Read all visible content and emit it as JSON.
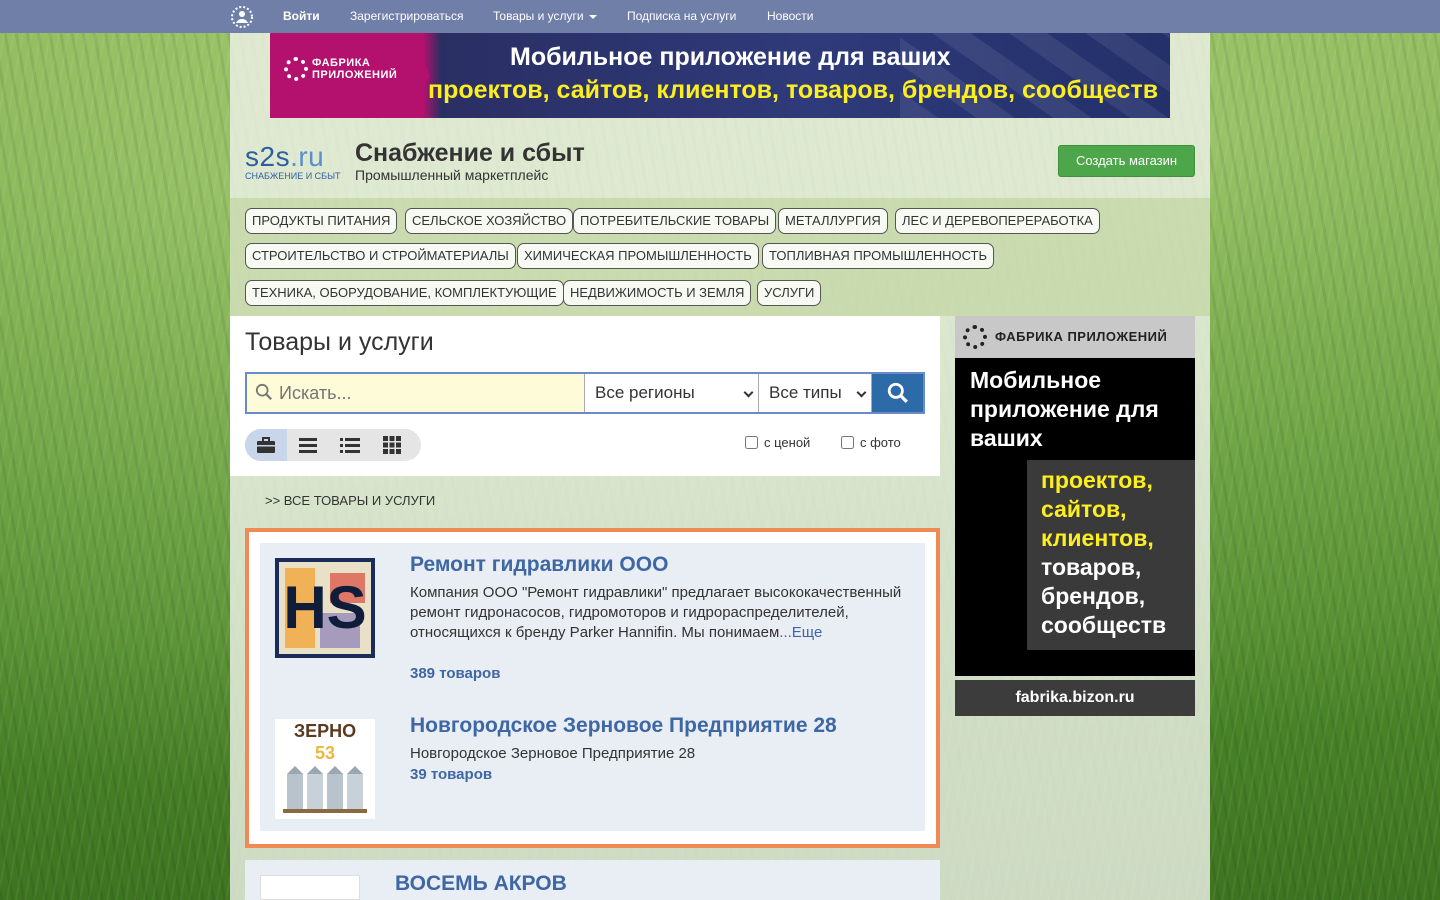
{
  "topbar": {
    "login": "Войти",
    "register": "Зарегистрироваться",
    "goods": "Товары и услуги",
    "subscribe": "Подписка на услуги",
    "news": "Новости"
  },
  "banner": {
    "brand": "ФАБРИКА ПРИЛОЖЕНИЙ",
    "line1": "Мобильное приложение для ваших",
    "line2": "проектов, сайтов,  клиентов, товаров, брендов, сообществ"
  },
  "header": {
    "logo_word": "s2s",
    "logo_tld": ".ru",
    "logo_sub": "СНАБЖЕНИЕ И СБЫТ",
    "title": "Снабжение и сбыт",
    "subtitle": "Промышленный маркетплейс",
    "create_shop": "Создать магазин"
  },
  "categories": [
    "ПРОДУКТЫ ПИТАНИЯ",
    "СЕЛЬСКОЕ ХОЗЯЙСТВО",
    "ПОТРЕБИТЕЛЬСКИЕ ТОВАРЫ",
    "МЕТАЛЛУРГИЯ",
    "ЛЕС И ДЕРЕВОПЕРЕРАБОТКА",
    "СТРОИТЕЛЬСТВО И СТРОЙМАТЕРИАЛЫ",
    "ХИМИЧЕСКАЯ ПРОМЫШЛЕННОСТЬ",
    "ТОПЛИВНАЯ ПРОМЫШЛЕННОСТЬ",
    "ТЕХНИКА, ОБОРУДОВАНИЕ, КОМПЛЕКТУЮЩИЕ",
    "НЕДВИЖИМОСТЬ И ЗЕМЛЯ",
    "УСЛУГИ"
  ],
  "main": {
    "title": "Товары и услуги",
    "search_placeholder": "Искать...",
    "region_select": "Все регионы",
    "type_select": "Все типы",
    "with_price": "с ценой",
    "with_photo": "с фото",
    "breadcrumb": ">> ВСЕ ТОВАРЫ И УСЛУГИ"
  },
  "results": [
    {
      "title": "Ремонт гидравлики ООО",
      "description": "Компания ООО \"Ремонт гидравлики\" предлагает высококачественный ремонт гидронасосов, гидромоторов и гидрораспределителей, относящихся к бренду Parker Hannifin. Мы понимаем",
      "more": "...Еще",
      "count": "389 товаров",
      "logo_text": "HS"
    },
    {
      "title": "Новгородское Зерновое Предприятие 28",
      "description": "Новгородское Зерновое Предприятие 28",
      "count": "39 товаров",
      "logo_text": "ЗЕРНО",
      "logo_num": "53"
    }
  ],
  "next_result": {
    "title": "ВОСЕМЬ АКРОВ"
  },
  "side_ad": {
    "brand": "ФАБРИКА ПРИЛОЖЕНИЙ",
    "lead": "Мобильное приложение для ваших",
    "list_yellow": [
      "проектов,",
      "сайтов,",
      "клиентов,"
    ],
    "list_white": [
      "товаров,",
      "брендов,",
      "сообществ"
    ],
    "url": "fabrika.bizon.ru"
  },
  "colors": {
    "topbar": "#6f7fa8",
    "accent_blue": "#3e67a3",
    "green_button": "#4ea64a",
    "highlight_border": "#f08a55",
    "banner_magenta": "#b4106e",
    "banner_yellow": "#fcee21"
  }
}
